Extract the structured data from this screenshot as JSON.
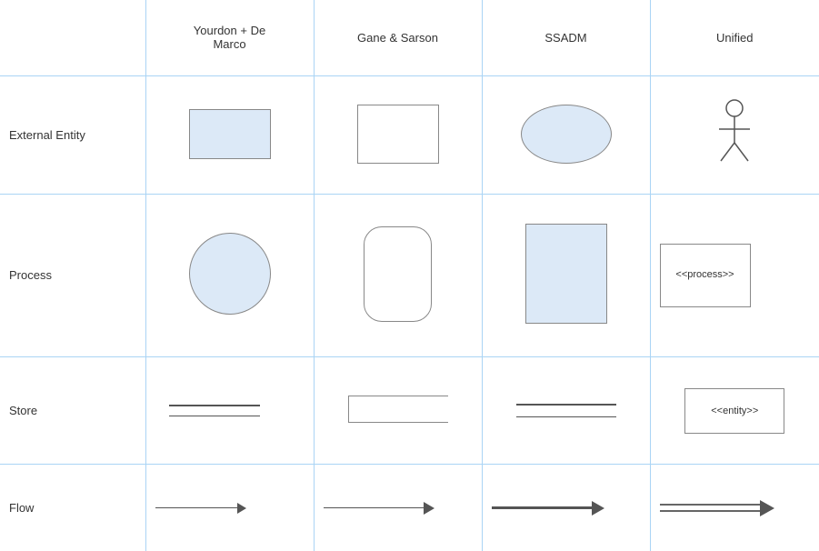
{
  "headers": {
    "col1": "Yourdon + De\nMarco",
    "col2": "Gane & Sarson",
    "col3": "SSADM",
    "col4": "Unified"
  },
  "rows": {
    "entity": {
      "label": "External Entity"
    },
    "process": {
      "label": "Process"
    },
    "store": {
      "label": "Store"
    },
    "flow": {
      "label": "Flow"
    }
  },
  "unified_process_label": "<<process>>",
  "unified_store_label": "<<entity>>"
}
